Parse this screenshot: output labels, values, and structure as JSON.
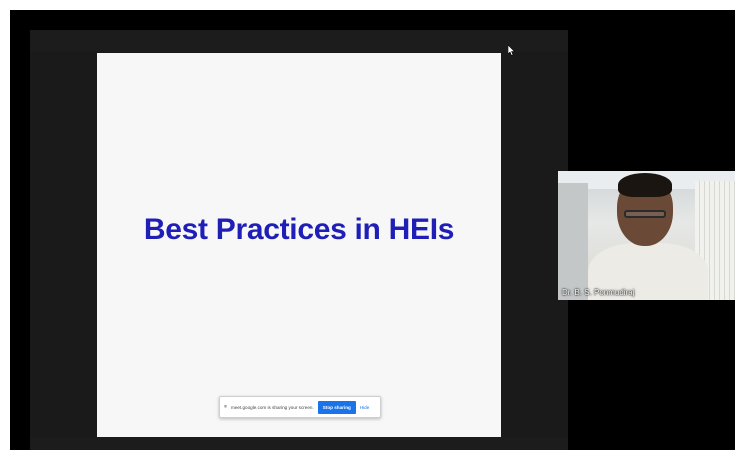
{
  "slide": {
    "title": "Best Practices in HEIs",
    "title_color": "#1f1fb8",
    "tools": [
      "arrow-icon",
      "pen-icon",
      "slides-icon",
      "zoom-icon"
    ]
  },
  "share_bar": {
    "message": "meet.google.com is sharing your screen.",
    "stop_label": "Stop sharing",
    "hide_label": "Hide",
    "accent_color": "#1a73e8"
  },
  "participant": {
    "name": "Dr. B. S. Ponmudiraj"
  },
  "icons": {
    "pointer": "mouse-cursor-icon",
    "share_indicator": "screen-share-icon"
  }
}
